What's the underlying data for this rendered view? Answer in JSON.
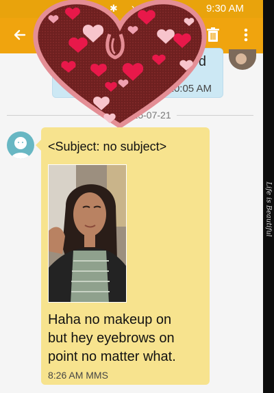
{
  "status_bar": {
    "time": "9:30 AM",
    "icons": "✱ ⋎"
  },
  "app_bar": {
    "back_icon": "arrow-left-icon",
    "delete_icon": "trash-icon",
    "more_icon": "more-vertical-icon",
    "color": "#f0a40e"
  },
  "thread": {
    "sent": {
      "text_fragment": "d",
      "time": "10:05 AM"
    },
    "date_divider": "2015-07-21",
    "received": {
      "subject": "<Subject: no subject>",
      "body": " Haha no makeup on\nbut hey eyebrows on\npoint no matter what.",
      "meta": "8:26 AM MMS",
      "bubble_color": "#f7e38e"
    }
  },
  "side_caption": "Life is Beautiful",
  "colors": {
    "accent": "#f0a40e",
    "sent_bubble": "#cce8f4",
    "heart": "#d98b91",
    "heart_fill": "#6e2020"
  }
}
